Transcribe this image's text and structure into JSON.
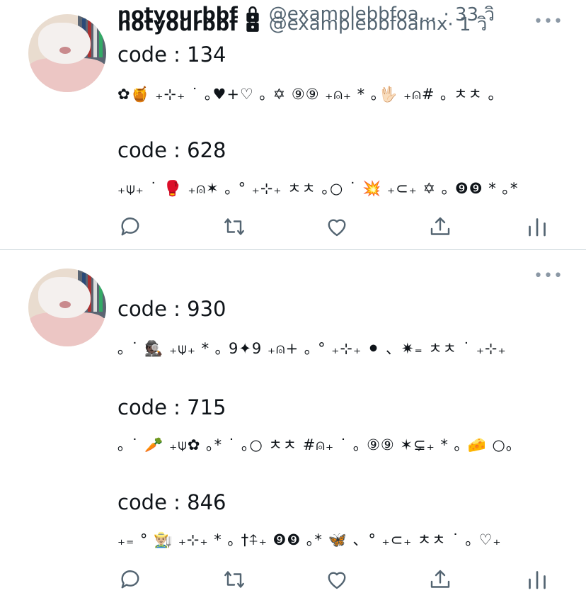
{
  "tweets": [
    {
      "name": "notyourbbf",
      "handle": "@examplebbfoamx",
      "time": "· 1 วิ",
      "more": "•••",
      "lines": [
        {
          "code": "code : 134",
          "deco": "✿🍯 ₊⊹₊ ˙ ｡♥+♡ ｡ ✡ ⑨⑨ ₊⍝₊ * ｡🖖🏻 ₊⍝# ｡ ㅊㅊ ｡"
        },
        {
          "code": "code : 628",
          "deco": "₊⍦₊ ˙ 🥊 ₊⍝✶ ｡ ° ₊⊹₊ ㅊㅊ ｡○ ˙ 💥 ₊⊂₊ ✡ ｡ ❾❾ * ｡*"
        }
      ]
    },
    {
      "name": "notyourbbf",
      "handle": "@examplebbfoa...",
      "time": "· 33 วิ",
      "more": "•••",
      "lines": [
        {
          "code": "code : 930",
          "deco": "｡ ˙ 🕵🏿 ₊⍦₊ * ｡ 9✦9 ₊⍝+ ｡ ° ₊⊹₊ ⚫ 、✷₌ ㅊㅊ ˙ ₊⊹₊"
        },
        {
          "code": "code : 715",
          "deco": "｡ ˙ 🥕 ₊⍦✿ ｡* ˙ ｡○ ㅊㅊ #⍝₊ ˙ ｡ ⑨⑨ ✶⊊₊ * ｡ 🧀 ○｡"
        },
        {
          "code": "code : 846",
          "deco": "₊₌ ° 👨🏼‍🌾 ₊⊹₊ * ｡ †⍏₊ ❾❾ ｡* 🦋 、° ₊⊂₊ ㅊㅊ ˙ ｡ ♡₊"
        }
      ]
    }
  ],
  "icons": {
    "reply": "reply-icon",
    "retweet": "retweet-icon",
    "like": "like-icon",
    "share": "share-icon",
    "analytics": "analytics-icon",
    "lock": "lock-icon"
  },
  "colors": {
    "text": "#0f1419",
    "secondary": "#536471",
    "icon": "#536471",
    "divider": "#cfd9de"
  }
}
